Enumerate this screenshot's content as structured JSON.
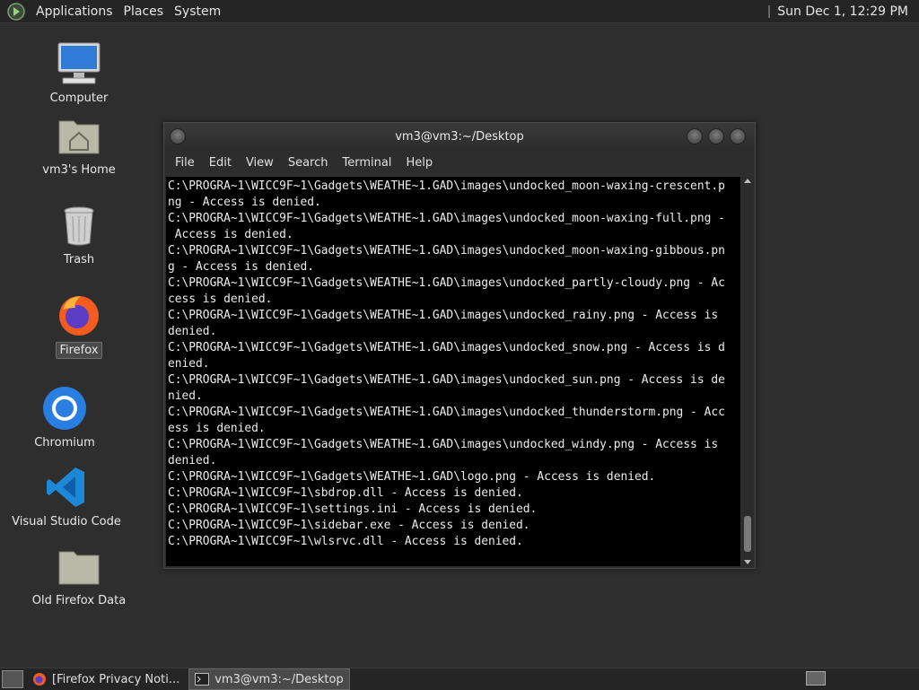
{
  "top_panel": {
    "menus": [
      "Applications",
      "Places",
      "System"
    ],
    "clock": "Sun Dec  1, 12:29 PM"
  },
  "desktop_icons": [
    {
      "label": "Computer",
      "icon": "computer-icon"
    },
    {
      "label": "vm3's Home",
      "icon": "home-folder-icon"
    },
    {
      "label": "Trash",
      "icon": "trash-icon"
    },
    {
      "label": "Firefox",
      "icon": "firefox-icon"
    },
    {
      "label": "Chromium",
      "icon": "chromium-icon"
    },
    {
      "label": "Visual Studio Code",
      "icon": "vscode-icon"
    },
    {
      "label": "Old Firefox Data",
      "icon": "folder-icon"
    }
  ],
  "terminal": {
    "title": "vm3@vm3:~/Desktop",
    "menu": [
      "File",
      "Edit",
      "View",
      "Search",
      "Terminal",
      "Help"
    ],
    "lines": [
      "C:\\PROGRA~1\\WICC9F~1\\Gadgets\\WEATHE~1.GAD\\images\\undocked_moon-waxing-crescent.p",
      "ng - Access is denied.",
      "C:\\PROGRA~1\\WICC9F~1\\Gadgets\\WEATHE~1.GAD\\images\\undocked_moon-waxing-full.png -",
      " Access is denied.",
      "C:\\PROGRA~1\\WICC9F~1\\Gadgets\\WEATHE~1.GAD\\images\\undocked_moon-waxing-gibbous.pn",
      "g - Access is denied.",
      "C:\\PROGRA~1\\WICC9F~1\\Gadgets\\WEATHE~1.GAD\\images\\undocked_partly-cloudy.png - Ac",
      "cess is denied.",
      "C:\\PROGRA~1\\WICC9F~1\\Gadgets\\WEATHE~1.GAD\\images\\undocked_rainy.png - Access is",
      "denied.",
      "C:\\PROGRA~1\\WICC9F~1\\Gadgets\\WEATHE~1.GAD\\images\\undocked_snow.png - Access is d",
      "enied.",
      "C:\\PROGRA~1\\WICC9F~1\\Gadgets\\WEATHE~1.GAD\\images\\undocked_sun.png - Access is de",
      "nied.",
      "C:\\PROGRA~1\\WICC9F~1\\Gadgets\\WEATHE~1.GAD\\images\\undocked_thunderstorm.png - Acc",
      "ess is denied.",
      "C:\\PROGRA~1\\WICC9F~1\\Gadgets\\WEATHE~1.GAD\\images\\undocked_windy.png - Access is",
      "denied.",
      "C:\\PROGRA~1\\WICC9F~1\\Gadgets\\WEATHE~1.GAD\\logo.png - Access is denied.",
      "C:\\PROGRA~1\\WICC9F~1\\sbdrop.dll - Access is denied.",
      "C:\\PROGRA~1\\WICC9F~1\\settings.ini - Access is denied.",
      "C:\\PROGRA~1\\WICC9F~1\\sidebar.exe - Access is denied.",
      "C:\\PROGRA~1\\WICC9F~1\\wlsrvc.dll - Access is denied."
    ]
  },
  "taskbar": {
    "items": [
      {
        "label": "[Firefox Privacy Noti...",
        "icon": "firefox-icon"
      },
      {
        "label": "vm3@vm3:~/Desktop",
        "icon": "terminal-icon"
      }
    ]
  }
}
